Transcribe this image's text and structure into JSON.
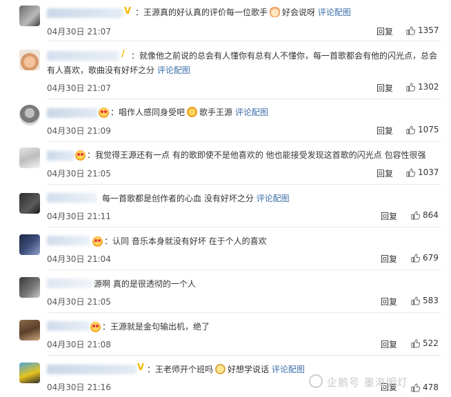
{
  "reply_label": "回复",
  "comments": [
    {
      "text": "：王源真的好认真的评价每一位歌手",
      "emoji": "heart-cat-emoji",
      "tail": "好会说呀",
      "link": "评论配图",
      "time": "04月30日 21:07",
      "likes": "1357"
    },
    {
      "text": "：就像他之前说的总会有人懂你有总有人不懂你，每一首歌都会有他的闪光点，总会",
      "text2": "有人喜欢，歌曲没有好坏之分",
      "link": "评论配图",
      "time": "04月30日 21:07",
      "likes": "1302"
    },
    {
      "text": "：唱作人感同身受吧",
      "emoji": "cheer-emoji",
      "tail": "歌手王源",
      "link": "评论配图",
      "time": "04月30日 21:09",
      "likes": "1075"
    },
    {
      "text": "：我觉得王源还有一点 有的歌即使不是他喜欢的 他也能接受发现这首歌的闪光点 包容性很强",
      "time": "04月30日 21:05",
      "likes": "1037"
    },
    {
      "text": "每一首歌都是创作者的心血 没有好坏之分",
      "link": "评论配图",
      "time": "04月30日 21:11",
      "likes": "864"
    },
    {
      "text": "：认同 音乐本身就没有好坏 在于个人的喜欢",
      "time": "04月30日 21:04",
      "likes": "679"
    },
    {
      "text": "源啊 真的是很透彻的一个人",
      "time": "04月30日 21:05",
      "likes": "583"
    },
    {
      "text": "：王源就是金句输出机，绝了",
      "time": "04月30日 21:08",
      "likes": "522"
    },
    {
      "text": "：王老师开个班吗",
      "emoji": "sleepy-emoji",
      "tail": "好想学说话",
      "link": "评论配图",
      "time": "04月30日 21:16",
      "likes": "478"
    }
  ],
  "watermark": "企鹅号 墨海明灯",
  "colors": {
    "link": "#3b6ea8",
    "vip": "#f7b500",
    "text": "#333333",
    "time": "#555555"
  }
}
